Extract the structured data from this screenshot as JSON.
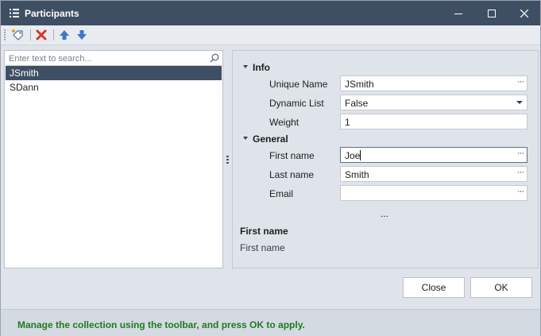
{
  "window": {
    "title": "Participants",
    "app_icon": "list-icon",
    "controls": [
      "minimize-icon",
      "maximize-icon",
      "close-icon"
    ]
  },
  "toolbar": {
    "items": [
      {
        "name": "add-item",
        "icon": "add-tag-icon"
      },
      {
        "name": "delete-item",
        "icon": "delete-x-icon",
        "color": "#d9342b"
      },
      {
        "name": "move-up",
        "icon": "arrow-up-icon",
        "color": "#3f78c5"
      },
      {
        "name": "move-down",
        "icon": "arrow-down-icon",
        "color": "#3f78c5"
      }
    ]
  },
  "list": {
    "search_placeholder": "Enter text to search...",
    "search_icon": "search-icon",
    "items": [
      {
        "label": "JSmith",
        "selected": true
      },
      {
        "label": "SDann",
        "selected": false
      }
    ]
  },
  "property_grid": {
    "categories": [
      {
        "label": "Info",
        "properties": [
          {
            "label": "Unique Name",
            "value": "JSmith",
            "editor": "ellipsis"
          },
          {
            "label": "Dynamic List",
            "value": "False",
            "editor": "dropdown"
          },
          {
            "label": "Weight",
            "value": "1",
            "editor": "text"
          }
        ]
      },
      {
        "label": "General",
        "properties": [
          {
            "label": "First name",
            "value": "Joe",
            "editor": "ellipsis",
            "focused": true
          },
          {
            "label": "Last name",
            "value": "Smith",
            "editor": "ellipsis"
          },
          {
            "label": "Email",
            "value": "",
            "editor": "ellipsis"
          }
        ]
      }
    ],
    "more_label": "...",
    "description": {
      "title": "First name",
      "text": "First name"
    }
  },
  "buttons": {
    "close_label": "Close",
    "ok_label": "OK"
  },
  "status": {
    "message": "Manage the collection using the toolbar, and press OK to apply.",
    "color": "#1f7a1f"
  },
  "colors": {
    "titlebar": "#3f4f63",
    "selection": "#3f4f63",
    "background": "#dfe3ea"
  }
}
